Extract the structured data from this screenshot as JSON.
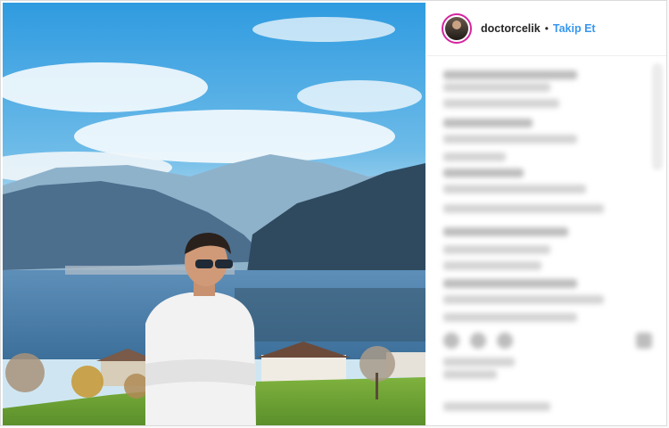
{
  "post": {
    "username": "doctorcelik",
    "separator": "•",
    "follow_label": "Takip Et"
  },
  "icons": [
    "avatar",
    "heart-icon",
    "comment-icon",
    "share-icon",
    "bookmark-icon"
  ],
  "colors": {
    "link": "#3897f0",
    "avatar_ring": "#d6249f",
    "text": "#262626"
  }
}
